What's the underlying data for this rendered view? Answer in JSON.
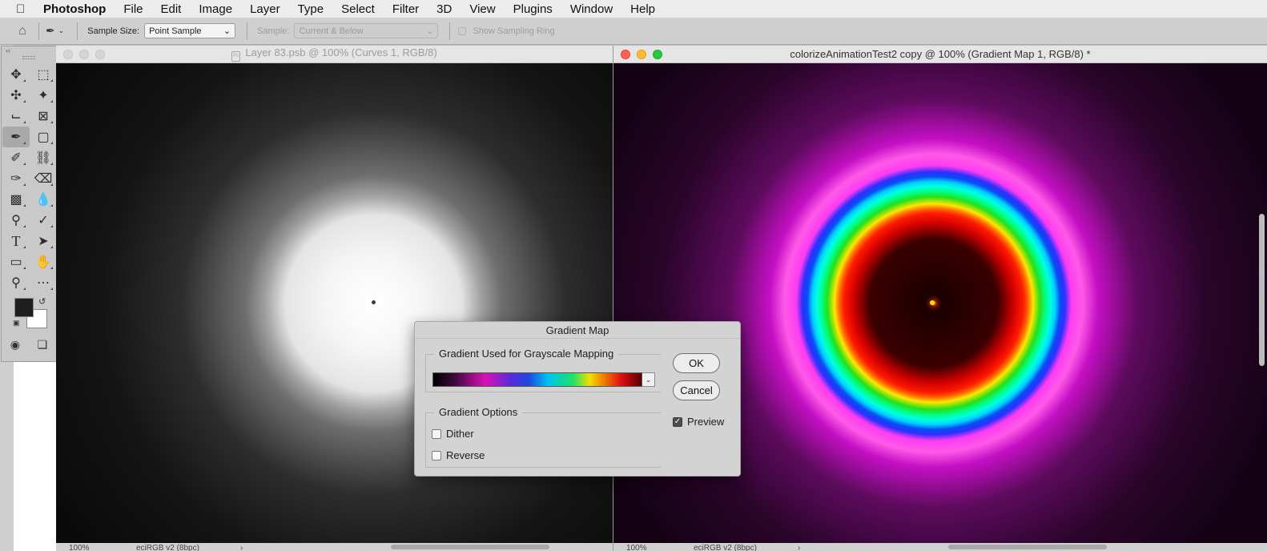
{
  "menubar": {
    "app_name": "Photoshop",
    "items": [
      "File",
      "Edit",
      "Image",
      "Layer",
      "Type",
      "Select",
      "Filter",
      "3D",
      "View",
      "Plugins",
      "Window",
      "Help"
    ]
  },
  "options": {
    "sample_size_label": "Sample Size:",
    "sample_size_value": "Point Sample",
    "sample_label": "Sample:",
    "sample_value": "Current & Below",
    "show_ring_label": "Show Sampling Ring"
  },
  "doc1": {
    "title": "Layer 83.psb @ 100% (Curves 1, RGB/8)",
    "file_icon": "Ps",
    "zoom": "100%",
    "profile": "eciRGB v2 (8bpc)"
  },
  "doc2": {
    "title": "colorizeAnimationTest2 copy @ 100% (Gradient Map 1, RGB/8) *",
    "zoom": "100%",
    "profile": "eciRGB v2 (8bpc)"
  },
  "dialog": {
    "title": "Gradient Map",
    "mapping_group": "Gradient Used for Grayscale Mapping",
    "options_group": "Gradient Options",
    "dither_label": "Dither",
    "dither_checked": false,
    "reverse_label": "Reverse",
    "reverse_checked": false,
    "ok_label": "OK",
    "cancel_label": "Cancel",
    "preview_label": "Preview",
    "preview_checked": true
  },
  "colors": {
    "foreground": "#1e1e1e",
    "background": "#ffffff"
  }
}
